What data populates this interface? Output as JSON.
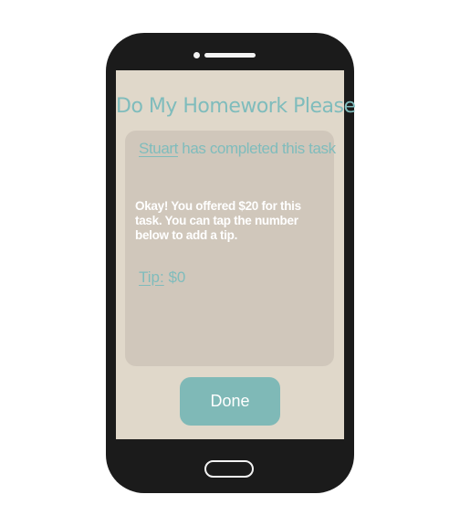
{
  "app": {
    "title": "Do My Homework Please"
  },
  "status": {
    "user_name": "Stuart",
    "completed_text": "has completed this task"
  },
  "message": {
    "text": "Okay! You offered $20 for this task. You can tap the number below to add a tip."
  },
  "tip": {
    "label": "Tip:",
    "value": "$0"
  },
  "actions": {
    "done_label": "Done"
  },
  "colors": {
    "accent": "#7fbcbc",
    "screen_background": "#e0d8ca",
    "card_background": "#d0c7bb",
    "phone_body": "#1b1b1b"
  }
}
